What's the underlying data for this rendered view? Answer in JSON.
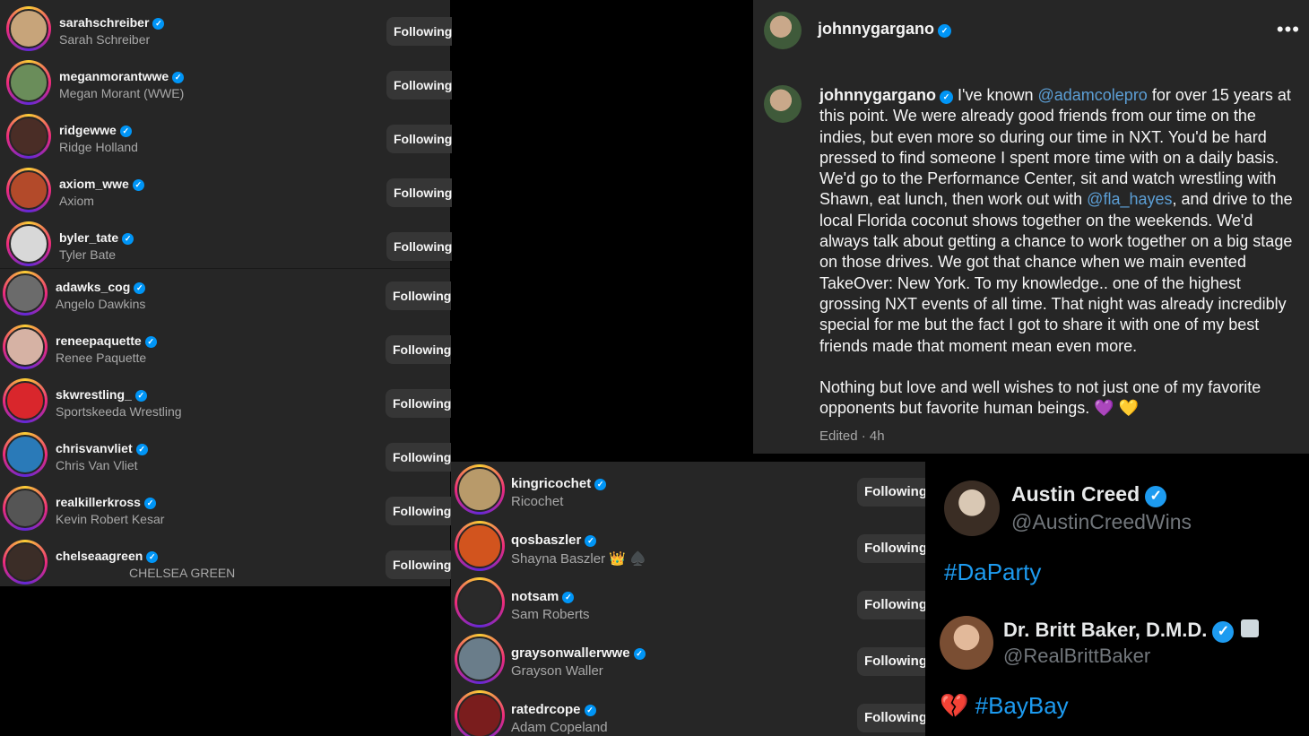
{
  "following_list": {
    "button_label": "Following",
    "items": [
      {
        "username": "sarahschreiber",
        "fullname": "Sarah Schreiber",
        "color": "#c7a47a"
      },
      {
        "username": "meganmorantwwe",
        "fullname": "Megan Morant (WWE)",
        "color": "#6a8d5a"
      },
      {
        "username": "ridgewwe",
        "fullname": "Ridge Holland",
        "color": "#4a2d26"
      },
      {
        "username": "axiom_wwe",
        "fullname": "Axiom",
        "color": "#b34a2a"
      },
      {
        "username": "byler_tate",
        "fullname": "Tyler Bate",
        "color": "#d8d8d8"
      },
      {
        "username": "adawks_cog",
        "fullname": "Angelo Dawkins",
        "color": "#6b6b6b"
      },
      {
        "username": "reneepaquette",
        "fullname": "Renee Paquette",
        "color": "#d6b2a4"
      },
      {
        "username": "skwrestling_",
        "fullname": "Sportskeeda Wrestling",
        "color": "#d9262c"
      },
      {
        "username": "chrisvanvliet",
        "fullname": "Chris Van Vliet",
        "color": "#2a7ab8"
      },
      {
        "username": "realkillerkross",
        "fullname": "Kevin Robert Kesar",
        "color": "#555555"
      },
      {
        "username": "chelseaagreen",
        "fullname": "CHELSEA GREEN",
        "color": "#3b2d27"
      }
    ]
  },
  "post": {
    "header_username": "johnnygargano",
    "author": "johnnygargano",
    "segments": [
      {
        "t": " I've known ",
        "link": false
      },
      {
        "t": "@adamcolepro",
        "link": true
      },
      {
        "t": " for over 15 years at this point. We were already good friends from our time on the indies, but even more so during our time in NXT. You'd be hard pressed to find someone I spent more time with on a daily basis. We'd go to the Performance Center, sit and watch wrestling with Shawn, eat lunch, then work out with ",
        "link": false
      },
      {
        "t": "@fla_hayes",
        "link": true
      },
      {
        "t": ", and drive to the local Florida coconut shows together on the weekends. We'd always talk about getting a chance to work together on a big stage on those drives. We got that chance when we main evented TakeOver: New York. To my knowledge.. one of the highest grossing NXT events of all time. That night was already incredibly special for me but the fact I got to share it with one of my best friends made that moment mean even more.",
        "link": false
      }
    ],
    "paragraph2": "Nothing but love and well wishes to not just one of my favorite opponents but favorite human beings. 💜 💛",
    "meta": "Edited · 4h"
  },
  "mid_list": {
    "button_label": "Following",
    "items": [
      {
        "username": "kingricochet",
        "fullname": "Ricochet",
        "color": "#b89a6a"
      },
      {
        "username": "qosbaszler",
        "fullname": "Shayna Baszler 👑 ♠️",
        "color": "#d2541e"
      },
      {
        "username": "notsam",
        "fullname": "Sam Roberts",
        "color": "#2a2a2a"
      },
      {
        "username": "graysonwallerwwe",
        "fullname": "Grayson Waller",
        "color": "#6a7d8a"
      },
      {
        "username": "ratedrcope",
        "fullname": "Adam Copeland",
        "color": "#7a1d1d"
      }
    ]
  },
  "tweets": [
    {
      "name": "Austin Creed",
      "handle": "@AustinCreedWins",
      "tag": "#DaParty",
      "prefix": "",
      "color": "#3a2d24"
    },
    {
      "name": "Dr. Britt Baker, D.M.D.",
      "handle": "@RealBrittBaker",
      "tag": "#BayBay",
      "prefix": "💔",
      "color": "#b07c56"
    }
  ],
  "colors": {
    "panel_bg": "#262626",
    "verified": "#0095f6",
    "twitter_blue": "#1d9bf0",
    "link": "#5c9fd6"
  }
}
